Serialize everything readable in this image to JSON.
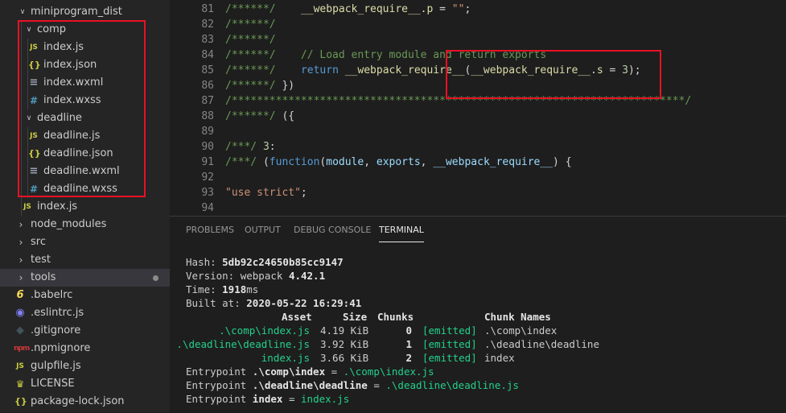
{
  "sidebar": {
    "items": [
      {
        "label": "miniprogram_dist",
        "kind": "folder-open"
      },
      {
        "label": "comp",
        "kind": "folder-open"
      },
      {
        "label": "index.js",
        "icon": "JS"
      },
      {
        "label": "index.json",
        "icon": "{}"
      },
      {
        "label": "index.wxml",
        "icon": "≡"
      },
      {
        "label": "index.wxss",
        "icon": "#"
      },
      {
        "label": "deadline",
        "kind": "folder-open"
      },
      {
        "label": "deadline.js",
        "icon": "JS"
      },
      {
        "label": "deadline.json",
        "icon": "{}"
      },
      {
        "label": "deadline.wxml",
        "icon": "≡"
      },
      {
        "label": "deadline.wxss",
        "icon": "#"
      },
      {
        "label": "index.js",
        "icon": "JS"
      },
      {
        "label": "node_modules",
        "kind": "folder-closed"
      },
      {
        "label": "src",
        "kind": "folder-closed"
      },
      {
        "label": "test",
        "kind": "folder-closed"
      },
      {
        "label": "tools",
        "kind": "folder-closed"
      },
      {
        "label": ".babelrc",
        "icon": "6"
      },
      {
        "label": ".eslintrc.js",
        "icon": "◉"
      },
      {
        "label": ".gitignore",
        "icon": "◆"
      },
      {
        "label": ".npmignore",
        "icon": "npm"
      },
      {
        "label": "gulpfile.js",
        "icon": "JS"
      },
      {
        "label": "LICENSE",
        "icon": "♛"
      },
      {
        "label": "package-lock.json",
        "icon": "{}"
      }
    ],
    "chevron_open": "∨",
    "chevron_closed": "›"
  },
  "editor": {
    "lines": [
      {
        "n": "81",
        "tokens": [
          [
            "c",
            "/******/"
          ],
          [
            "p",
            "    "
          ],
          [
            "f",
            "__webpack_require__"
          ],
          [
            "p",
            "."
          ],
          [
            "f",
            "p"
          ],
          [
            "p",
            " = "
          ],
          [
            "s",
            "\"\""
          ],
          [
            "p",
            ";"
          ]
        ]
      },
      {
        "n": "82",
        "tokens": [
          [
            "c",
            "/******/"
          ]
        ]
      },
      {
        "n": "83",
        "tokens": [
          [
            "c",
            "/******/"
          ]
        ]
      },
      {
        "n": "84",
        "tokens": [
          [
            "c",
            "/******/    // Load entry module and return exports"
          ]
        ]
      },
      {
        "n": "85",
        "tokens": [
          [
            "c",
            "/******/"
          ],
          [
            "p",
            "    "
          ],
          [
            "k",
            "return"
          ],
          [
            "p",
            " "
          ],
          [
            "f",
            "__webpack_require__"
          ],
          [
            "p",
            "("
          ],
          [
            "f",
            "__webpack_require__"
          ],
          [
            "p",
            "."
          ],
          [
            "f",
            "s"
          ],
          [
            "p",
            " = "
          ],
          [
            "n",
            "3"
          ],
          [
            "p",
            ");"
          ]
        ]
      },
      {
        "n": "86",
        "tokens": [
          [
            "c",
            "/******/"
          ],
          [
            "p",
            " })"
          ]
        ]
      },
      {
        "n": "87",
        "tokens": [
          [
            "c",
            "/************************************************************************/"
          ]
        ]
      },
      {
        "n": "88",
        "tokens": [
          [
            "c",
            "/******/"
          ],
          [
            "p",
            " ({"
          ]
        ]
      },
      {
        "n": "89",
        "tokens": []
      },
      {
        "n": "90",
        "tokens": [
          [
            "c",
            "/***/"
          ],
          [
            "p",
            " "
          ],
          [
            "n",
            "3"
          ],
          [
            "p",
            ":"
          ]
        ]
      },
      {
        "n": "91",
        "tokens": [
          [
            "c",
            "/***/"
          ],
          [
            "p",
            " ("
          ],
          [
            "k",
            "function"
          ],
          [
            "p",
            "("
          ],
          [
            "v",
            "module"
          ],
          [
            "p",
            ", "
          ],
          [
            "v",
            "exports"
          ],
          [
            "p",
            ", "
          ],
          [
            "v",
            "__webpack_require__"
          ],
          [
            "p",
            ") {"
          ]
        ]
      },
      {
        "n": "92",
        "tokens": []
      },
      {
        "n": "93",
        "tokens": [
          [
            "s",
            "\"use strict\""
          ],
          [
            "p",
            ";"
          ]
        ]
      },
      {
        "n": "94",
        "tokens": []
      }
    ]
  },
  "panel": {
    "tabs": [
      "PROBLEMS",
      "OUTPUT",
      "DEBUG CONSOLE",
      "TERMINAL"
    ],
    "active_tab": "TERMINAL",
    "terminal": {
      "hash_label": "Hash: ",
      "hash": "5db92c24650b85cc9147",
      "version_label": "Version: webpack ",
      "version": "4.42.1",
      "time_label": "Time: ",
      "time": "1918",
      "time_unit": "ms",
      "built_label": "Built at: ",
      "built": "2020-05-22 16:29:41",
      "table_headers": [
        "Asset",
        "Size",
        "Chunks",
        "",
        "Chunk Names"
      ],
      "rows": [
        {
          "asset": ".\\comp\\index.js",
          "size": "4.19 KiB",
          "chunk": "0",
          "status": "[emitted]",
          "name": ".\\comp\\index"
        },
        {
          "asset": ".\\deadline\\deadline.js",
          "size": "3.92 KiB",
          "chunk": "1",
          "status": "[emitted]",
          "name": ".\\deadline\\deadline"
        },
        {
          "asset": "index.js",
          "size": "3.66 KiB",
          "chunk": "2",
          "status": "[emitted]",
          "name": "index"
        }
      ],
      "entrypoints": [
        {
          "prefix": "Entrypoint ",
          "name": ".\\comp\\index",
          "eq": " = ",
          "file": ".\\comp\\index.js"
        },
        {
          "prefix": "Entrypoint ",
          "name": ".\\deadline\\deadline",
          "eq": " = ",
          "file": ".\\deadline\\deadline.js"
        },
        {
          "prefix": "Entrypoint ",
          "name": "index",
          "eq": " = ",
          "file": "index.js"
        }
      ]
    }
  },
  "colors": {
    "annotation": "#e81123",
    "green": "#23d18b",
    "comment": "#6a9955",
    "keyword": "#569cd6",
    "string": "#ce9178",
    "function": "#dcdcaa"
  }
}
